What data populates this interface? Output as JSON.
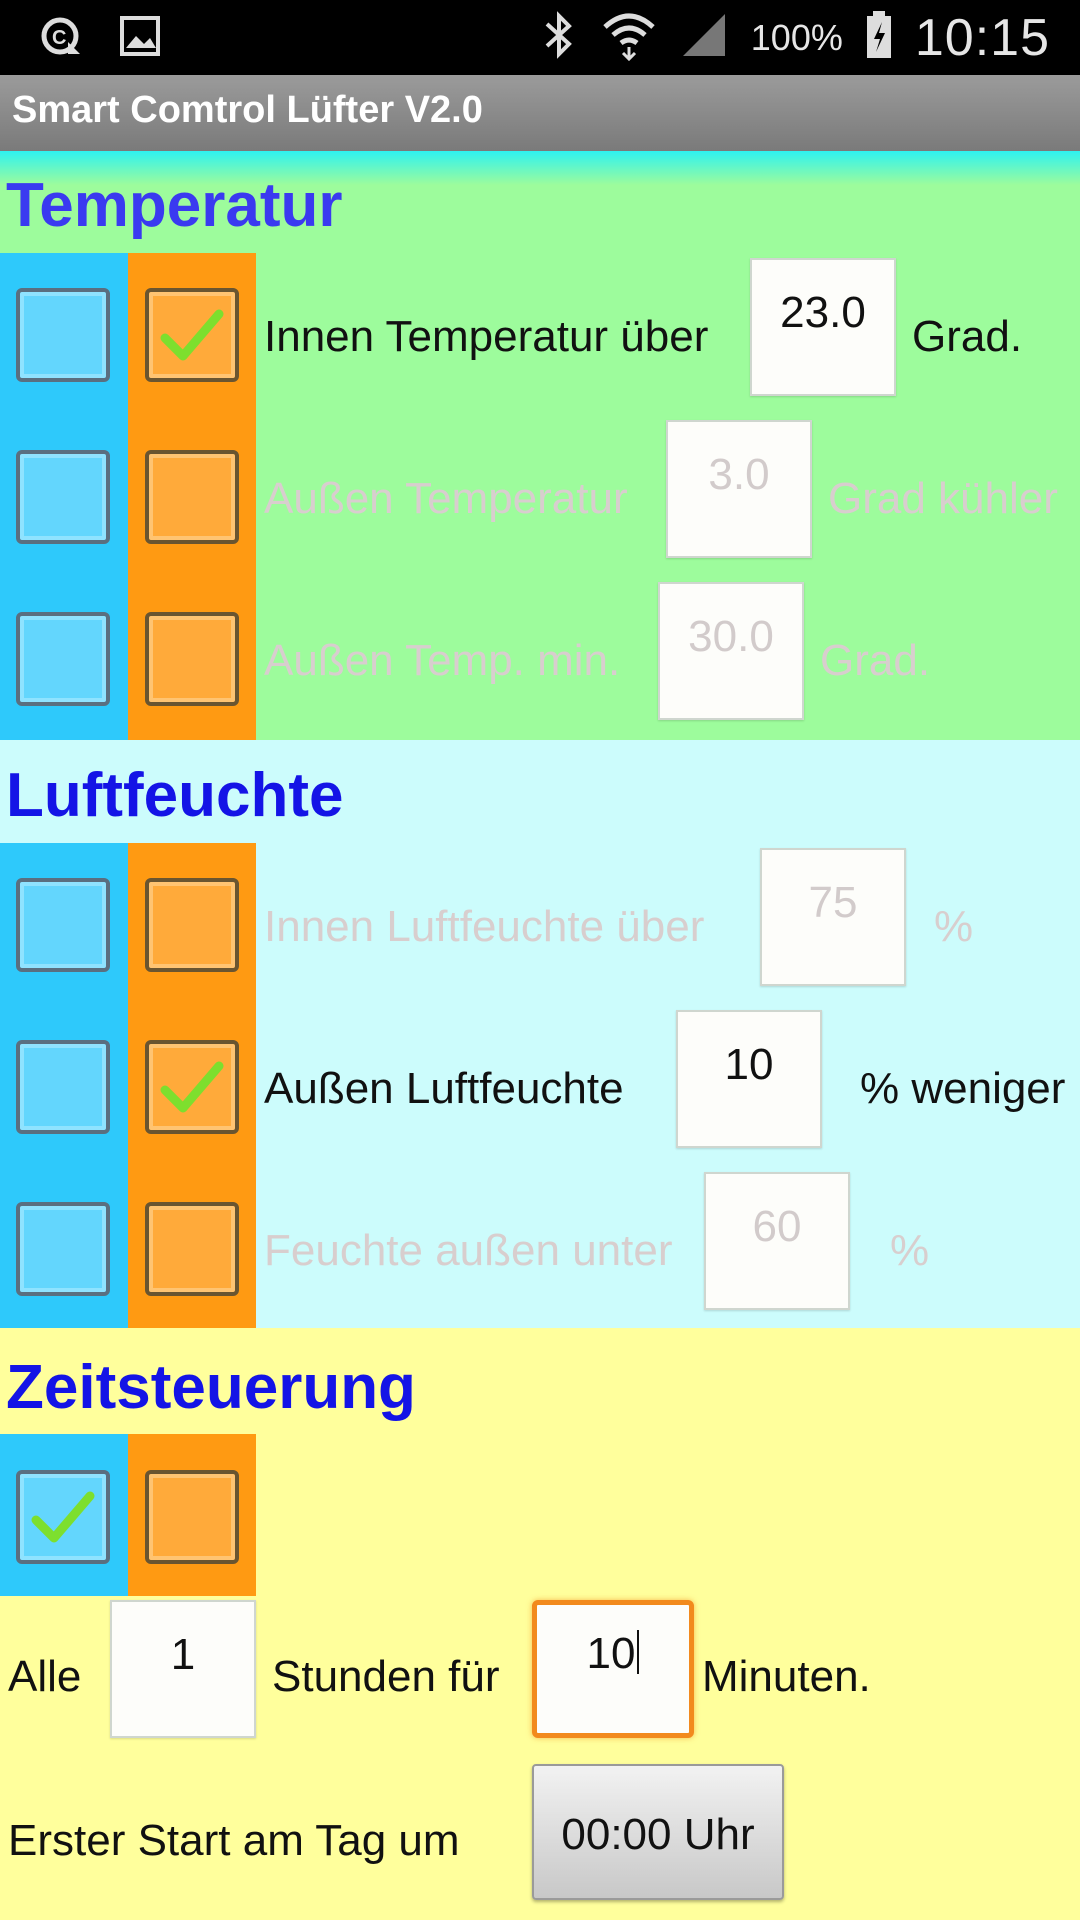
{
  "status_bar": {
    "icons_left": [
      "data-saver-icon",
      "image-icon"
    ],
    "icons_right": [
      "bluetooth-icon",
      "wifi-icon",
      "signal-icon"
    ],
    "battery": "100%",
    "time": "10:15"
  },
  "app": {
    "title": "Smart Comtrol Lüfter V2.0"
  },
  "colors": {
    "temperature_bg": "#9dfc9c",
    "humidity_bg": "#ccfcfc",
    "time_bg": "#ffff9c",
    "blue_column": "#2ec9fb",
    "orange_column": "#ff9a12",
    "section_title": "#2222ee"
  },
  "temperature": {
    "title": "Temperatur",
    "rows": [
      {
        "blue_checked": false,
        "orange_checked": true,
        "enabled": true,
        "label": "Innen Temperatur über",
        "value": "23.0",
        "unit": "Grad."
      },
      {
        "blue_checked": false,
        "orange_checked": false,
        "enabled": false,
        "label": "Außen Temperatur",
        "value": "3.0",
        "unit": "Grad kühler"
      },
      {
        "blue_checked": false,
        "orange_checked": false,
        "enabled": false,
        "label": "Außen Temp. min.",
        "value": "30.0",
        "unit": "Grad."
      }
    ]
  },
  "humidity": {
    "title": "Luftfeuchte",
    "rows": [
      {
        "blue_checked": false,
        "orange_checked": false,
        "enabled": false,
        "label": "Innen Luftfeuchte über",
        "value": "75",
        "unit": "%"
      },
      {
        "blue_checked": false,
        "orange_checked": true,
        "enabled": true,
        "label": "Außen Luftfeuchte",
        "value": "10",
        "unit": "% weniger"
      },
      {
        "blue_checked": false,
        "orange_checked": false,
        "enabled": false,
        "label": "Feuchte außen unter",
        "value": "60",
        "unit": "%"
      }
    ]
  },
  "timer": {
    "title": "Zeitsteuerung",
    "blue_checked": true,
    "orange_checked": false,
    "every_label": "Alle",
    "hours_value": "1",
    "hours_label": "Stunden für",
    "minutes_value": "10",
    "minutes_label": "Minuten.",
    "first_start_label": "Erster Start am Tag um",
    "first_start_button": "00:00 Uhr"
  }
}
